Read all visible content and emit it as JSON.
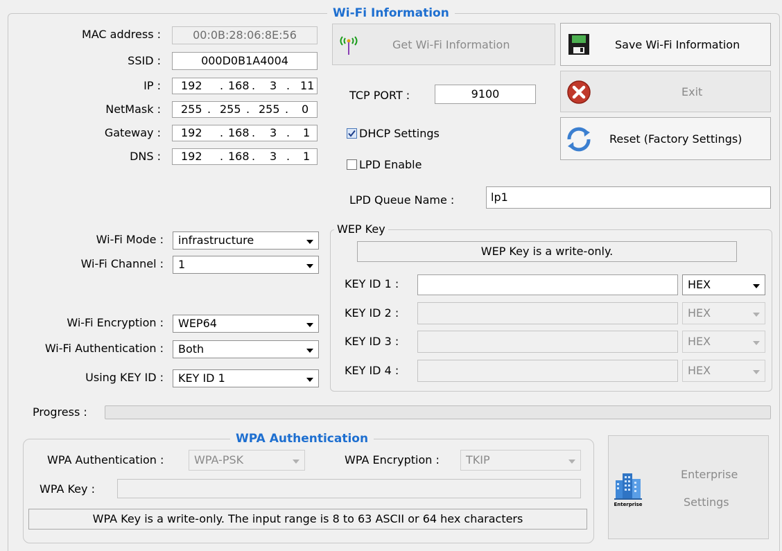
{
  "wifi_group": {
    "title": "Wi-Fi Information",
    "mac_label": "MAC address :",
    "mac_value": "00:0B:28:06:8E:56",
    "ssid_label": "SSID :",
    "ssid_value": "000D0B1A4004",
    "ip_label": "IP :",
    "ip_octets": [
      "192",
      "168",
      "3",
      "11"
    ],
    "netmask_label": "NetMask :",
    "netmask_octets": [
      "255",
      "255",
      "255",
      "0"
    ],
    "gateway_label": "Gateway :",
    "gateway_octets": [
      "192",
      "168",
      "3",
      "1"
    ],
    "dns_label": "DNS :",
    "dns_octets": [
      "192",
      "168",
      "3",
      "1"
    ],
    "ip_separator": ".",
    "tcp_port_label": "TCP PORT :",
    "tcp_port_value": "9100",
    "dhcp_label": "DHCP Settings",
    "dhcp_checked": true,
    "lpd_label": "LPD Enable",
    "lpd_checked": false,
    "lpd_queue_label": "LPD Queue Name :",
    "lpd_queue_value": "lp1",
    "mode_label": "Wi-Fi Mode :",
    "mode_value": "infrastructure",
    "channel_label": "Wi-Fi Channel :",
    "channel_value": "1",
    "encryption_label": "Wi-Fi Encryption :",
    "encryption_value": "WEP64",
    "auth_label": "Wi-Fi Authentication :",
    "auth_value": "Both",
    "key_id_label": "Using KEY ID :",
    "key_id_value": "KEY ID 1"
  },
  "buttons": {
    "get_info": "Get Wi-Fi Information",
    "save_info": "Save Wi-Fi Information",
    "exit": "Exit",
    "reset": "Reset (Factory Settings)",
    "enterprise_line1": "Enterprise",
    "enterprise_line2": "Settings",
    "enterprise_icon_caption": "Enterprise"
  },
  "wep": {
    "title": "WEP Key",
    "note": "WEP Key is a write-only.",
    "keys": [
      {
        "label": "KEY ID 1 :",
        "format": "HEX"
      },
      {
        "label": "KEY ID 2 :",
        "format": "HEX"
      },
      {
        "label": "KEY ID 3 :",
        "format": "HEX"
      },
      {
        "label": "KEY ID 4 :",
        "format": "HEX"
      }
    ]
  },
  "progress": {
    "label": "Progress :",
    "value": 0
  },
  "wpa": {
    "title": "WPA Authentication",
    "auth_label": "WPA Authentication :",
    "auth_value": "WPA-PSK",
    "encryption_label": "WPA Encryption :",
    "encryption_value": "TKIP",
    "key_label": "WPA Key :",
    "note": "WPA Key is a write-only. The input range is 8 to 63 ASCII or 64 hex characters"
  },
  "colors": {
    "legend_blue": "#1e6fd0",
    "exit_red": "#c0392b",
    "save_icon_green": "#4caf50"
  }
}
